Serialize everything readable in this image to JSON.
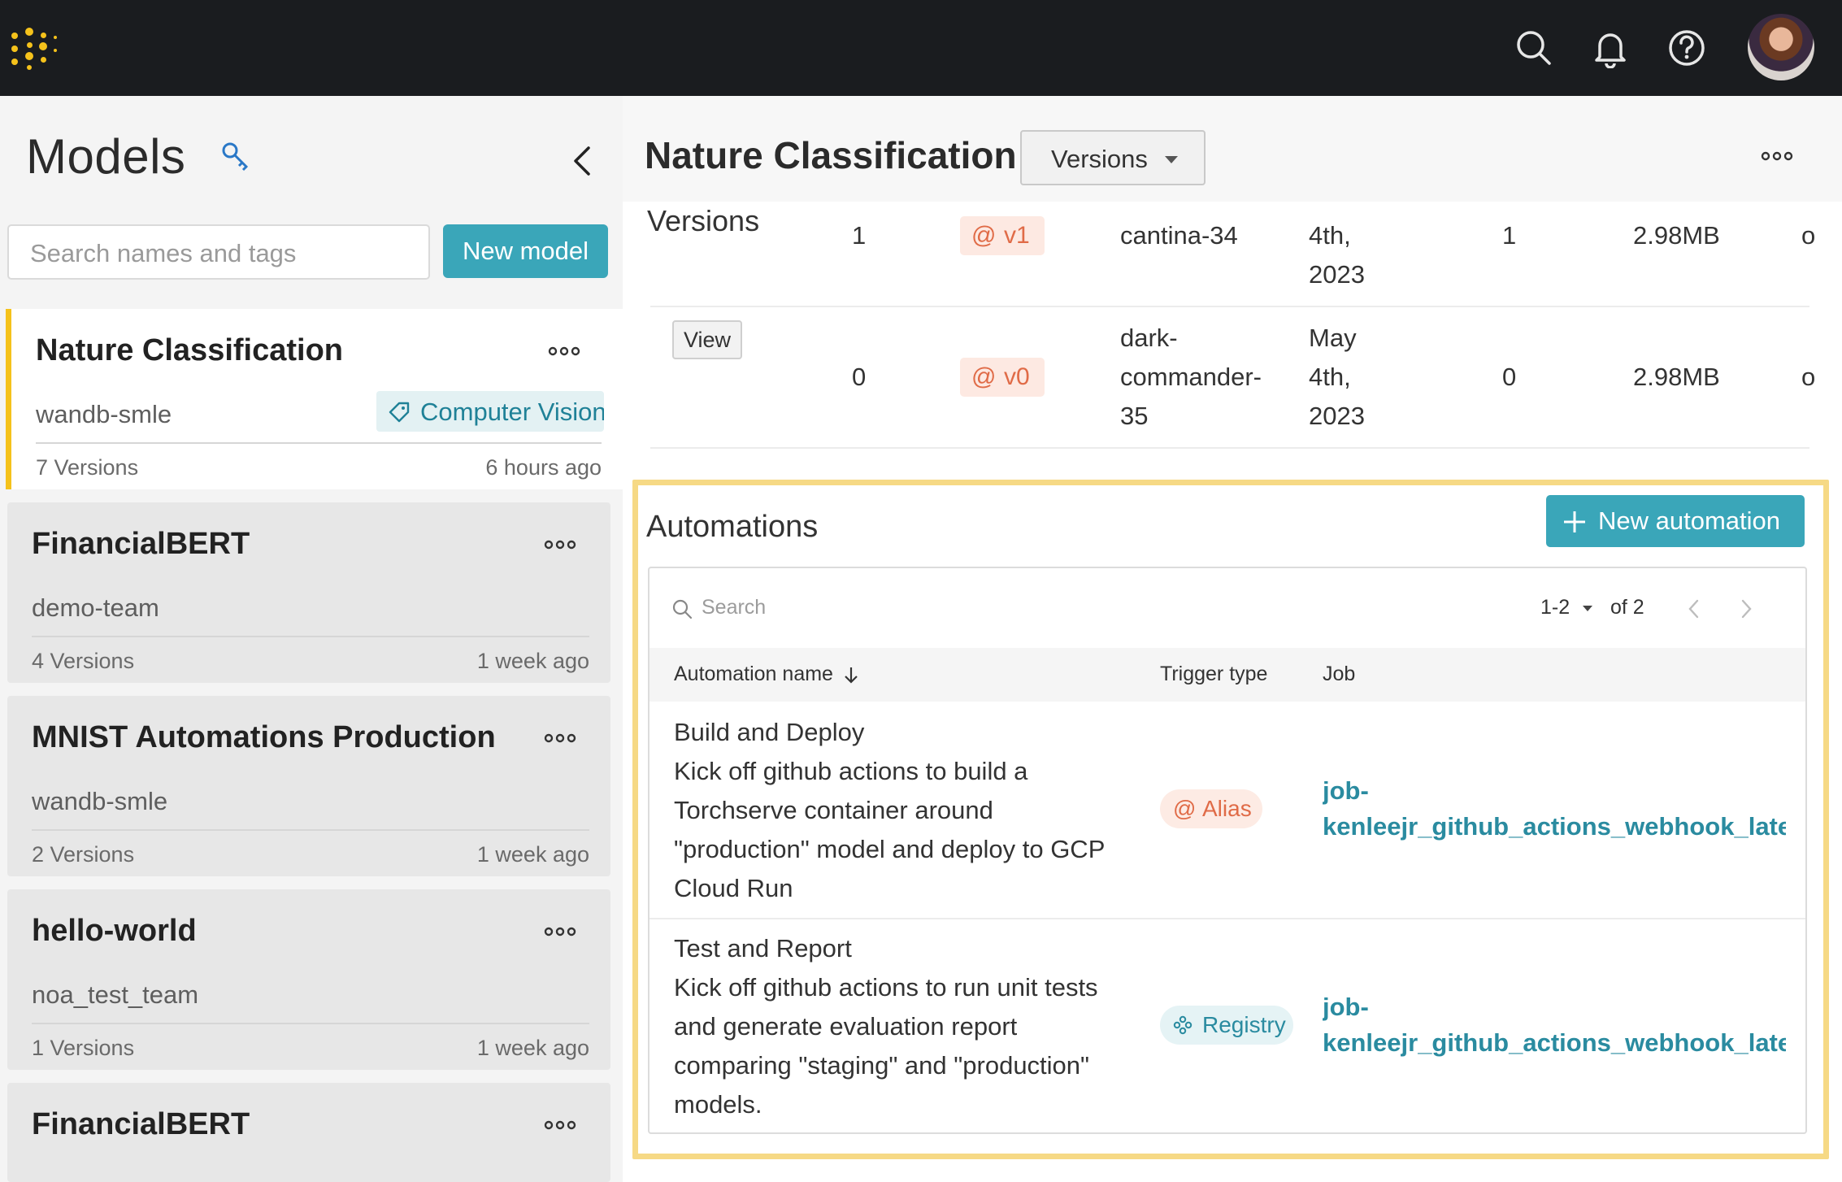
{
  "nav": {
    "logo": "wandb-logo-icon",
    "icons": [
      "search-icon",
      "bell-icon",
      "help-icon"
    ],
    "avatar": "user-avatar"
  },
  "sidebar": {
    "title": "Models",
    "search_placeholder": "Search names and tags",
    "new_model_label": "New model",
    "models": [
      {
        "name": "Nature Classification",
        "team": "wandb-smle",
        "tag": "Computer Vision",
        "versions": "7 Versions",
        "time": "6 hours ago",
        "active": true
      },
      {
        "name": "FinancialBERT",
        "team": "demo-team",
        "versions": "4 Versions",
        "time": "1 week ago"
      },
      {
        "name": "MNIST Automations Production",
        "team": "wandb-smle",
        "versions": "2 Versions",
        "time": "1 week ago"
      },
      {
        "name": "hello-world",
        "team": "noa_test_team",
        "versions": "1 Versions",
        "time": "1 week ago"
      },
      {
        "name": "FinancialBERT"
      }
    ]
  },
  "main": {
    "title": "Nature Classification",
    "view_select": "Versions",
    "versions_section_label": "Versions",
    "versions_rows": [
      {
        "index": "1",
        "alias": "v1",
        "run_lines": [
          "cantina-34"
        ],
        "date_lines": [
          "4th,",
          "2023"
        ],
        "count": "1",
        "size": "2.98MB",
        "extra": "o"
      },
      {
        "view_label": "View",
        "index": "0",
        "alias": "v0",
        "run_lines": [
          "dark-",
          "commander-",
          "35"
        ],
        "date_lines": [
          "May",
          "4th,",
          "2023"
        ],
        "count": "0",
        "size": "2.98MB",
        "extra": "o"
      }
    ],
    "automations": {
      "title": "Automations",
      "new_label": "New automation",
      "search_placeholder": "Search",
      "pager_range": "1-2",
      "pager_of": "of 2",
      "columns": [
        "Automation name",
        "Trigger type",
        "Job"
      ],
      "rows": [
        {
          "name": "Build and Deploy",
          "desc_lines": [
            "Kick off github actions to build a",
            "Torchserve container around",
            "\"production\" model and deploy to GCP",
            "Cloud Run"
          ],
          "trigger": "Alias",
          "job_lines": [
            "job-",
            "kenleejr_github_actions_webhook_latest"
          ]
        },
        {
          "name": "Test and Report",
          "desc_lines": [
            "Kick off github actions to run unit tests",
            "and generate evaluation report",
            "comparing \"staging\" and \"production\"",
            "models."
          ],
          "trigger": "Registry",
          "job_lines": [
            "job-",
            "kenleejr_github_actions_webhook_latest"
          ]
        }
      ]
    }
  },
  "colors": {
    "accent": "#3aa6b9",
    "highlight_border": "#f6d985",
    "active_bar": "#f5c21b",
    "alias": "#e06b47",
    "link": "#2a8ba0"
  }
}
